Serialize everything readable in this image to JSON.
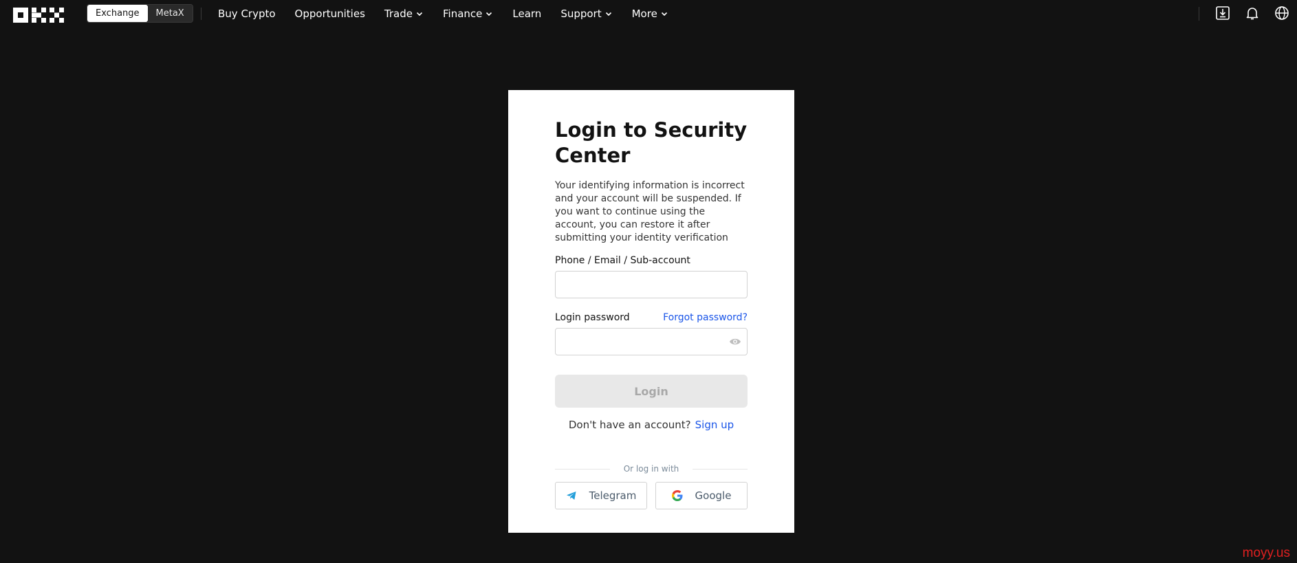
{
  "topbar": {
    "switch": [
      "Exchange",
      "MetaX"
    ],
    "nav": [
      {
        "label": "Buy Crypto",
        "has_menu": false
      },
      {
        "label": "Opportunities",
        "has_menu": false
      },
      {
        "label": "Trade",
        "has_menu": true
      },
      {
        "label": "Finance",
        "has_menu": true
      },
      {
        "label": "Learn",
        "has_menu": false
      },
      {
        "label": "Support",
        "has_menu": true
      },
      {
        "label": "More",
        "has_menu": true
      }
    ],
    "icons": [
      "download-icon",
      "bell-icon",
      "globe-icon"
    ]
  },
  "login": {
    "title": "Login to Security Center",
    "description": "Your identifying information is incorrect and your account will be suspended. If you want to continue using the account, you can restore it after submitting your identity verification",
    "account_label": "Phone / Email / Sub-account",
    "account_value": "",
    "password_label": "Login password",
    "password_value": "",
    "forgot_label": "Forgot password?",
    "login_button": "Login",
    "no_account_text": "Don't have an account?",
    "signup_label": "Sign up",
    "or_log_in_with": "Or log in with",
    "social": {
      "telegram": "Telegram",
      "google": "Google"
    }
  },
  "watermark": "moyy.us",
  "colors": {
    "background": "#121212",
    "link": "#1a55e8",
    "watermark": "#e02020"
  }
}
